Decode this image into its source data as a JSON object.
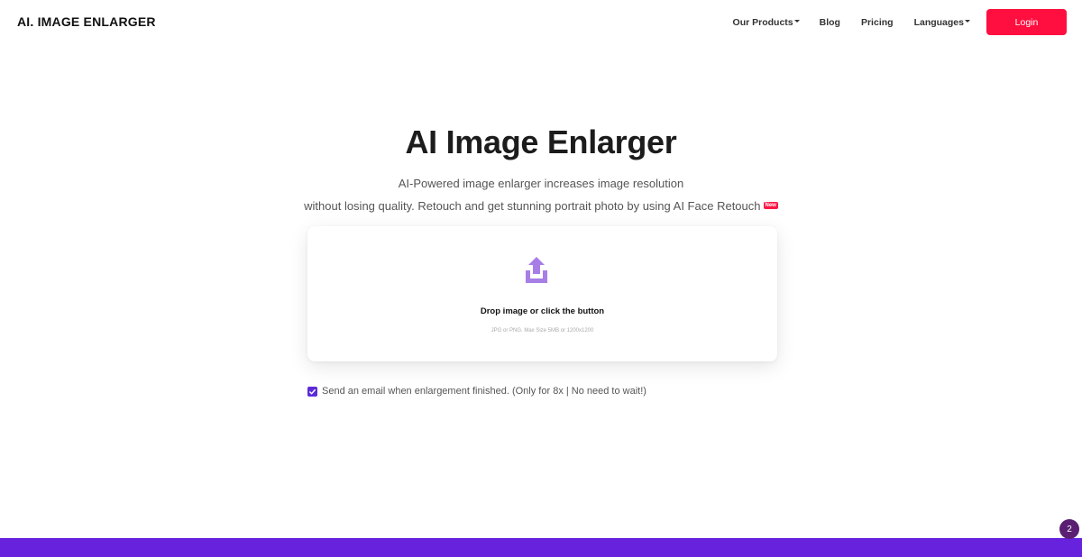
{
  "header": {
    "logo": "AI. IMAGE ENLARGER",
    "nav": {
      "products": "Our Products",
      "blog": "Blog",
      "pricing": "Pricing",
      "languages": "Languages"
    },
    "login_label": "Login"
  },
  "hero": {
    "title": "AI Image Enlarger",
    "subtitle_line1": "AI-Powered image enlarger increases image resolution",
    "subtitle_line2": "without losing quality. Retouch and get stunning portrait photo by using AI Face Retouch",
    "new_badge": "New"
  },
  "upload": {
    "icon": "upload-icon",
    "drop_text": "Drop image or click the button",
    "hint": "JPG or PNG. Max Size 5MB or 1200x1200"
  },
  "email_option": {
    "checked": true,
    "label": "Send an email when enlargement finished. (Only for 8x | No need to wait!)"
  },
  "notification": {
    "count": "2"
  },
  "colors": {
    "accent": "#ff0f3f",
    "upload_icon": "#a77ee6",
    "checkbox": "#5b2bd9",
    "footer_band": "#6622dd",
    "badge": "#5a1f72"
  }
}
